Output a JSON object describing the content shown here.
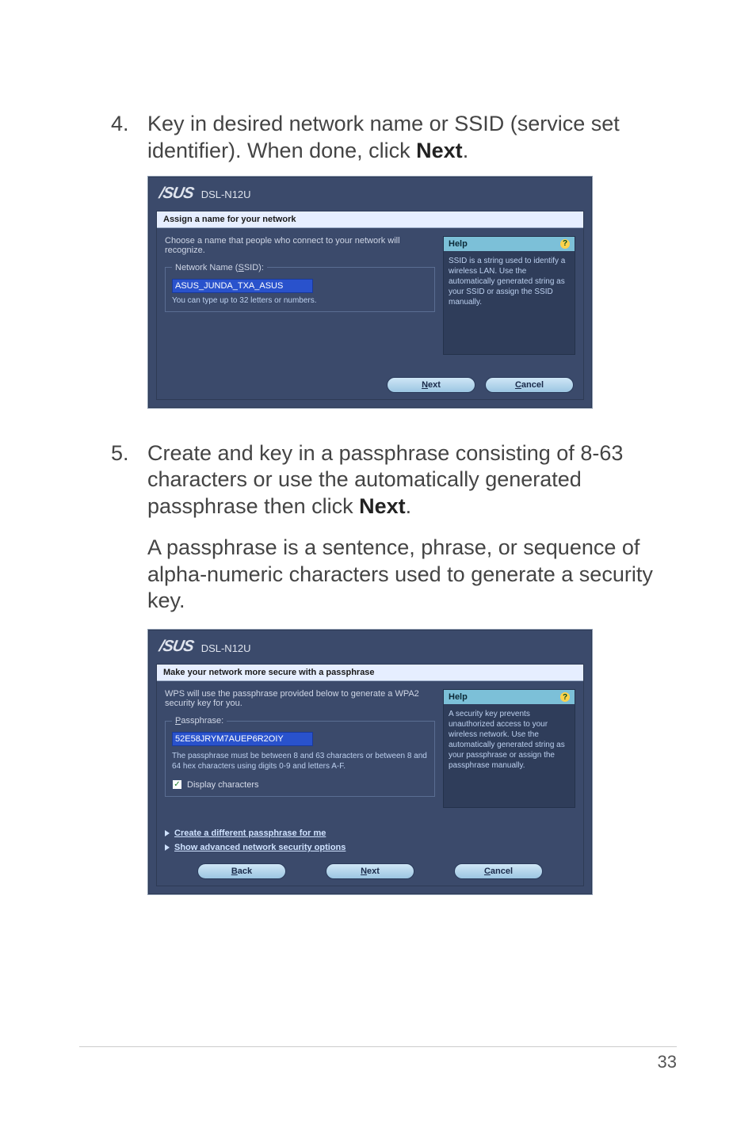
{
  "step4": {
    "num": "4.",
    "text_a": "Key in desired network name or SSID (service set identifier). When done, click ",
    "text_b": "Next",
    "text_c": "."
  },
  "step5": {
    "num": "5.",
    "text_a": "Create and key in a passphrase consisting of 8-63 characters or use the automatically generated passphrase then click ",
    "text_b": "Next",
    "text_c": ".",
    "para2": "A passphrase is a sentence, phrase, or sequence of alpha-numeric characters used to generate a security key."
  },
  "dialog1": {
    "logo": "/SUS",
    "model": "DSL-N12U",
    "section_title": "Assign a name for your network",
    "intro": "Choose a name that people who connect to your network will recognize.",
    "legend_pre": "Network Name (",
    "legend_ul": "S",
    "legend_post": "SID):",
    "input_value": "ASUS_JUNDA_TXA_ASUS",
    "hint": "You can type up to 32 letters or numbers.",
    "help": {
      "title": "Help",
      "body": "SSID is a string used to identify a wireless LAN. Use the automatically generated string as your SSID or assign the SSID manually."
    },
    "buttons": {
      "next_ul": "N",
      "next_rest": "ext",
      "cancel_ul": "C",
      "cancel_rest": "ancel"
    }
  },
  "dialog2": {
    "logo": "/SUS",
    "model": "DSL-N12U",
    "section_title": "Make your network more secure with a passphrase",
    "intro": "WPS will use the passphrase provided below to generate a WPA2 security key for you.",
    "legend_ul": "P",
    "legend_post": "assphrase:",
    "input_value": "52E58JRYM7AUEP6R2OIY",
    "passlines": "The passphrase must be between 8 and 63 characters or between 8 and 64 hex characters using digits 0-9 and letters A-F.",
    "chk_ul": "D",
    "chk_rest": "isplay characters",
    "link1": "Create a different passphrase for me",
    "link2": "Show advanced network security options",
    "help": {
      "title": "Help",
      "body": "A security key prevents unauthorized access to your wireless network. Use the automatically generated string as your passphrase or assign the passphrase manually."
    },
    "buttons": {
      "back_ul": "B",
      "back_rest": "ack",
      "next_ul": "N",
      "next_rest": "ext",
      "cancel_ul": "C",
      "cancel_rest": "ancel"
    }
  },
  "page_number": "33"
}
